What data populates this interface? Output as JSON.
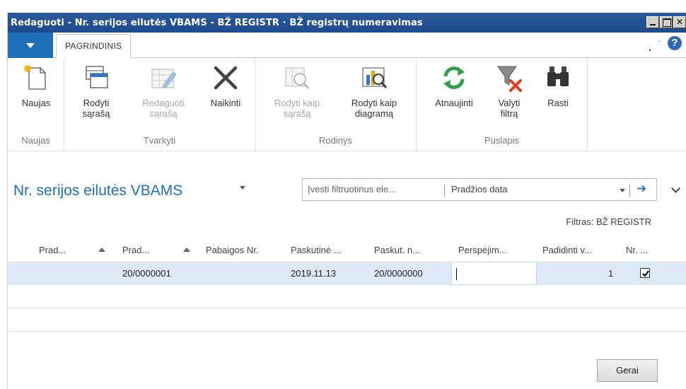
{
  "window": {
    "title": "Redaguoti - Nr. serijos eilutės VBAMS - BŽ REGISTR · BŽ registrų numeravimas"
  },
  "tabs": {
    "main": "PAGRINDINIS"
  },
  "ribbon": {
    "groups": [
      {
        "label": "Naujas",
        "buttons": [
          {
            "label": "Naujas",
            "icon": "new-document-icon",
            "disabled": false
          }
        ]
      },
      {
        "label": "Tvarkyti",
        "buttons": [
          {
            "label": "Rodyti\nsąrašą",
            "icon": "show-list-icon",
            "disabled": false
          },
          {
            "label": "Redaguoti\nsąrašą",
            "icon": "edit-list-icon",
            "disabled": true
          },
          {
            "label": "Naikinti",
            "icon": "delete-icon",
            "disabled": false
          }
        ]
      },
      {
        "label": "Rodinys",
        "buttons": [
          {
            "label": "Rodyti kaip\nsąrašą",
            "icon": "view-as-list-icon",
            "disabled": true
          },
          {
            "label": "Rodyti kaip\ndiagramą",
            "icon": "view-as-chart-icon",
            "disabled": false
          }
        ]
      },
      {
        "label": "Puslapis",
        "buttons": [
          {
            "label": "Atnaujinti",
            "icon": "refresh-icon",
            "disabled": false
          },
          {
            "label": "Valyti\nfiltrą",
            "icon": "clear-filter-icon",
            "disabled": false
          },
          {
            "label": "Rasti",
            "icon": "find-binoculars-icon",
            "disabled": false
          }
        ]
      }
    ]
  },
  "page": {
    "title": "Nr. serijos eilutės VBAMS",
    "filter_placeholder": "Įvesti filtruotinus ele...",
    "filter_field": "Pradžios data",
    "filter_applied": "Filtras: BŽ REGISTR"
  },
  "grid": {
    "columns": [
      "Prad...",
      "Prad...",
      "Pabaigos Nr.",
      "Paskutinė ...",
      "Paskut. n...",
      "Perspėjim...",
      "Padidinti v...",
      "Nr. ..."
    ],
    "rows": [
      {
        "starting_no": "20/0000001",
        "last_date": "2019.11.13",
        "last_no": "20/0000000",
        "increment": "1",
        "checked": true
      }
    ]
  },
  "actions": {
    "ok": "Gerai"
  },
  "colors": {
    "titlebar": "#1d4a8c",
    "accent": "#1e6fb8",
    "selected_row": "#dde9f7"
  }
}
